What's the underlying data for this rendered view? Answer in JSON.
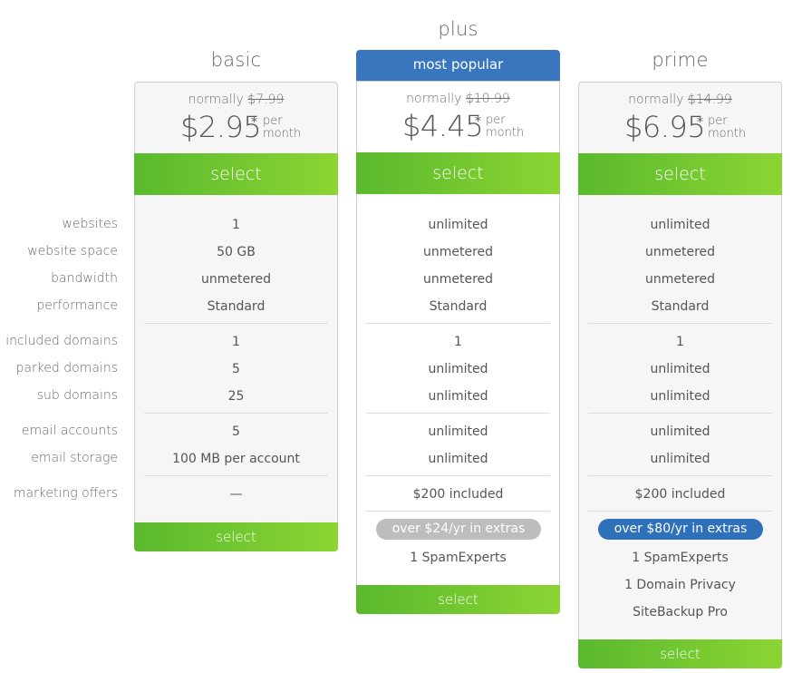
{
  "feature_labels": [
    "websites",
    "website space",
    "bandwidth",
    "performance",
    "included domains",
    "parked domains",
    "sub domains",
    "email accounts",
    "email storage",
    "marketing offers"
  ],
  "plans": [
    {
      "name": "basic",
      "badge": null,
      "normally_label": "normally",
      "normal_price": "$7.99",
      "price": "$2.95",
      "price_marker": "*",
      "per_label": "per",
      "month_label": "month",
      "select_label": "select",
      "features": [
        "1",
        "50 GB",
        "unmetered",
        "Standard",
        "1",
        "5",
        "25",
        "5",
        "100 MB per account",
        "—"
      ],
      "extras_pill": null,
      "extras": [],
      "bottom_select_label": "select"
    },
    {
      "name": "plus",
      "badge": "most popular",
      "normally_label": "normally",
      "normal_price": "$10.99",
      "price": "$4.45",
      "price_marker": "*",
      "per_label": "per",
      "month_label": "month",
      "select_label": "select",
      "features": [
        "unlimited",
        "unmetered",
        "unmetered",
        "Standard",
        "1",
        "unlimited",
        "unlimited",
        "unlimited",
        "unlimited",
        "$200 included"
      ],
      "extras_pill": "over $24/yr in extras",
      "extras": [
        "1 SpamExperts"
      ],
      "bottom_select_label": "select"
    },
    {
      "name": "prime",
      "badge": null,
      "normally_label": "normally",
      "normal_price": "$14.99",
      "price": "$6.95",
      "price_marker": "*",
      "per_label": "per",
      "month_label": "month",
      "select_label": "select",
      "features": [
        "unlimited",
        "unmetered",
        "unmetered",
        "Standard",
        "1",
        "unlimited",
        "unlimited",
        "unlimited",
        "unlimited",
        "$200 included"
      ],
      "extras_pill": "over $80/yr in extras",
      "extras": [
        "1 SpamExperts",
        "1 Domain Privacy",
        "SiteBackup Pro"
      ],
      "bottom_select_label": "select"
    }
  ],
  "colors": {
    "badge_blue": "#3a76bd",
    "pill_blue": "#2f70ba",
    "pill_grey": "#bdbdbd",
    "select_green_start": "#5ab92e",
    "select_green_end": "#8bd532"
  }
}
